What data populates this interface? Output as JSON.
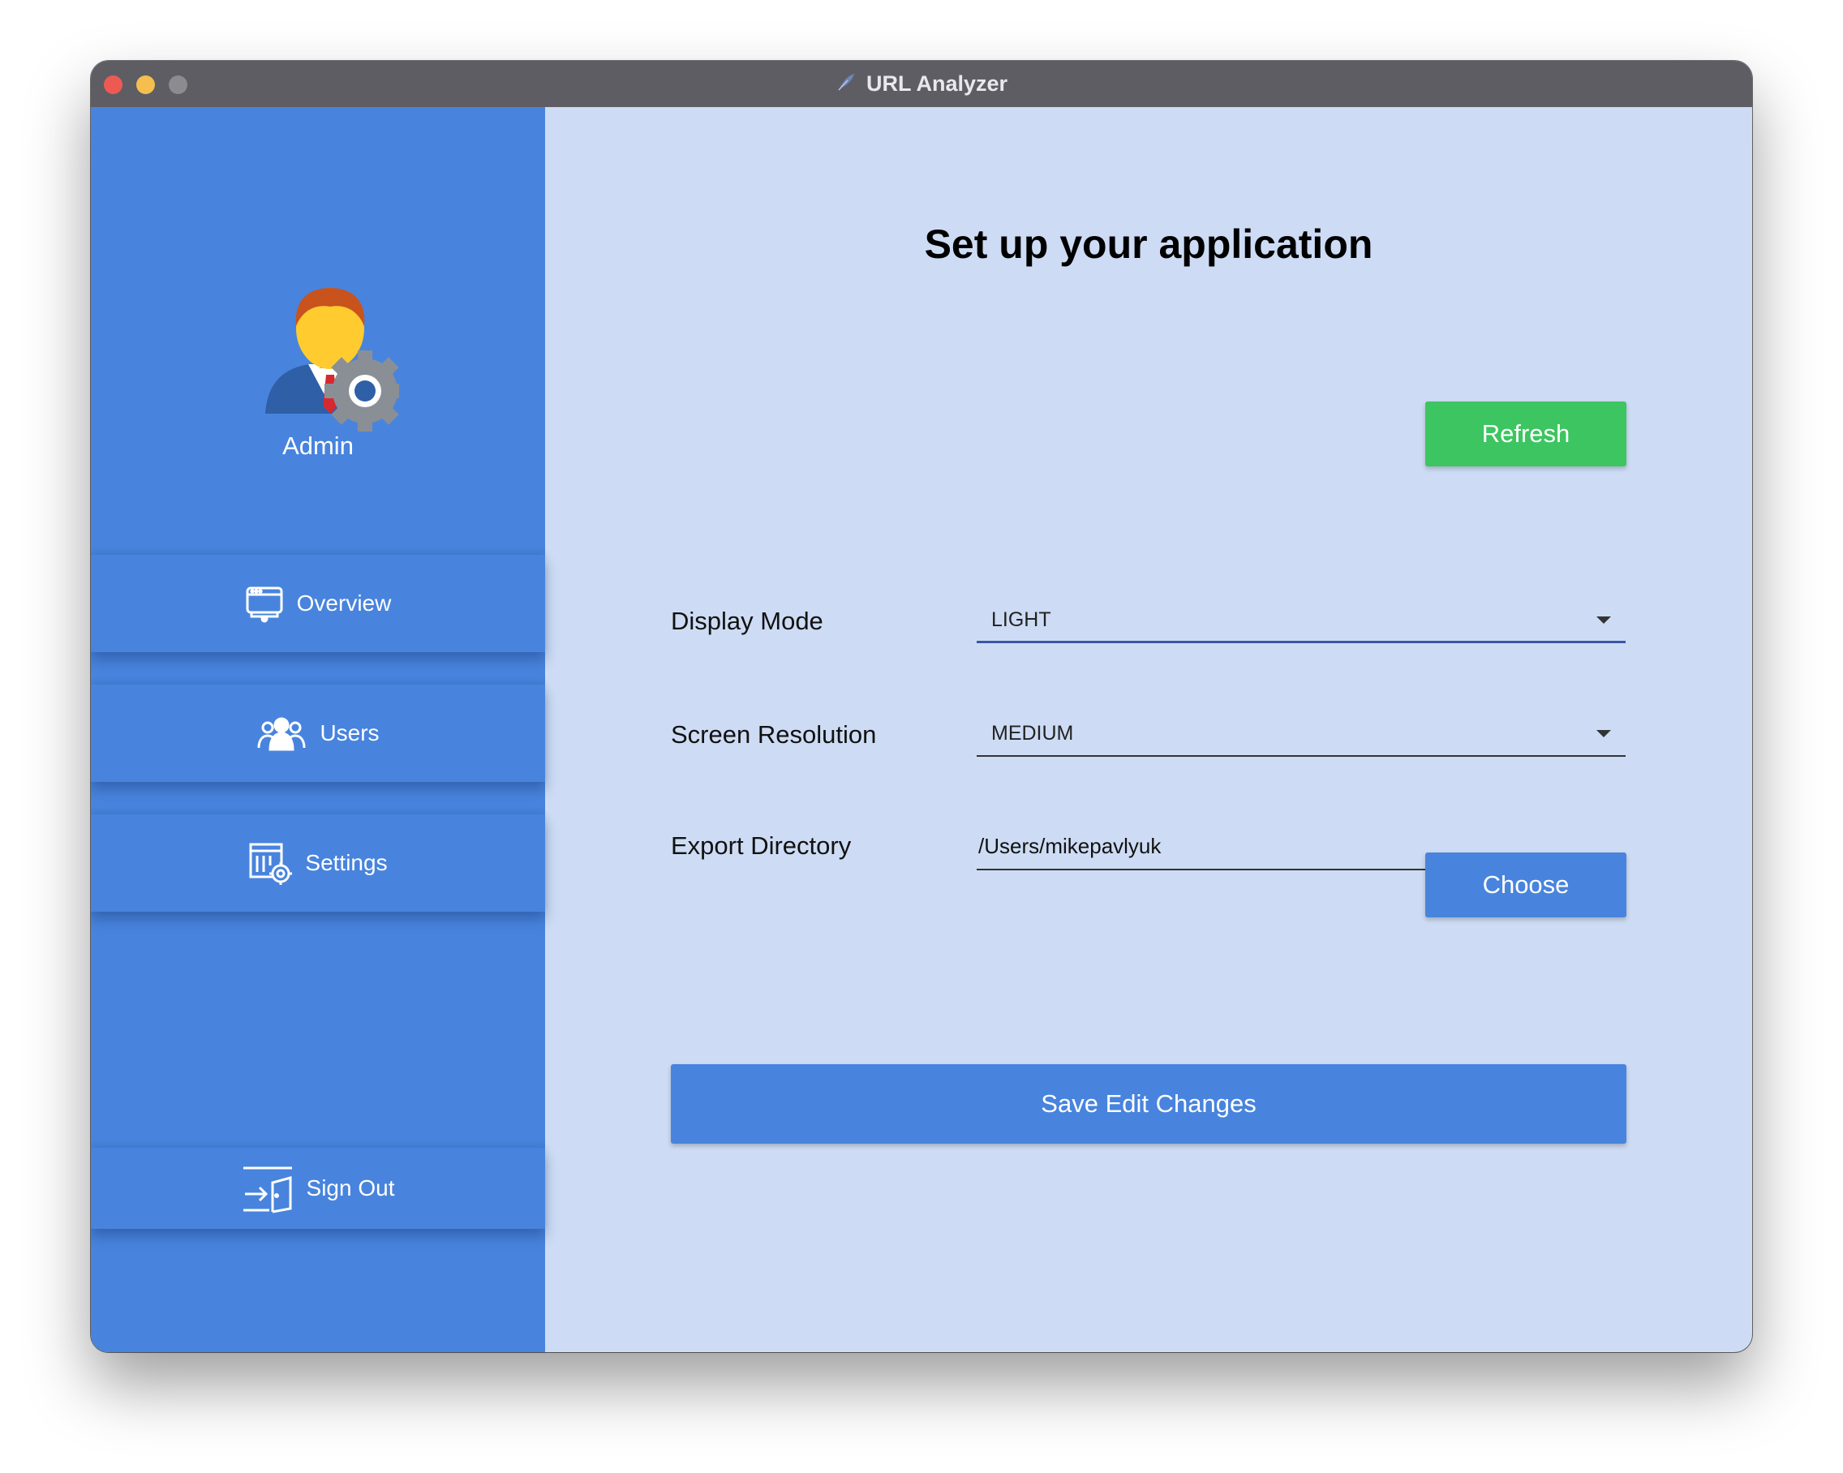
{
  "window": {
    "title": "URL Analyzer",
    "app_icon": "feather-icon"
  },
  "sidebar": {
    "user_label": "Admin",
    "avatar_icon": "admin-avatar-icon",
    "items": [
      {
        "label": "Overview",
        "icon": "monitor-icon"
      },
      {
        "label": "Users",
        "icon": "users-icon"
      },
      {
        "label": "Settings",
        "icon": "settings-icon"
      },
      {
        "label": "Sign Out",
        "icon": "sign-out-icon"
      }
    ]
  },
  "main": {
    "heading": "Set up your application",
    "refresh_label": "Refresh",
    "display_mode": {
      "label": "Display Mode",
      "value": "LIGHT"
    },
    "screen_resolution": {
      "label": "Screen Resolution",
      "value": "MEDIUM"
    },
    "export_directory": {
      "label": "Export Directory",
      "value": "/Users/mikepavlyuk"
    },
    "choose_label": "Choose",
    "save_label": "Save Edit Changes"
  },
  "colors": {
    "sidebar": "#4884dd",
    "main_background": "#cddcf4",
    "refresh_button": "#3cc560",
    "primary_button": "#4884dd",
    "titlebar": "#5f5d64"
  }
}
